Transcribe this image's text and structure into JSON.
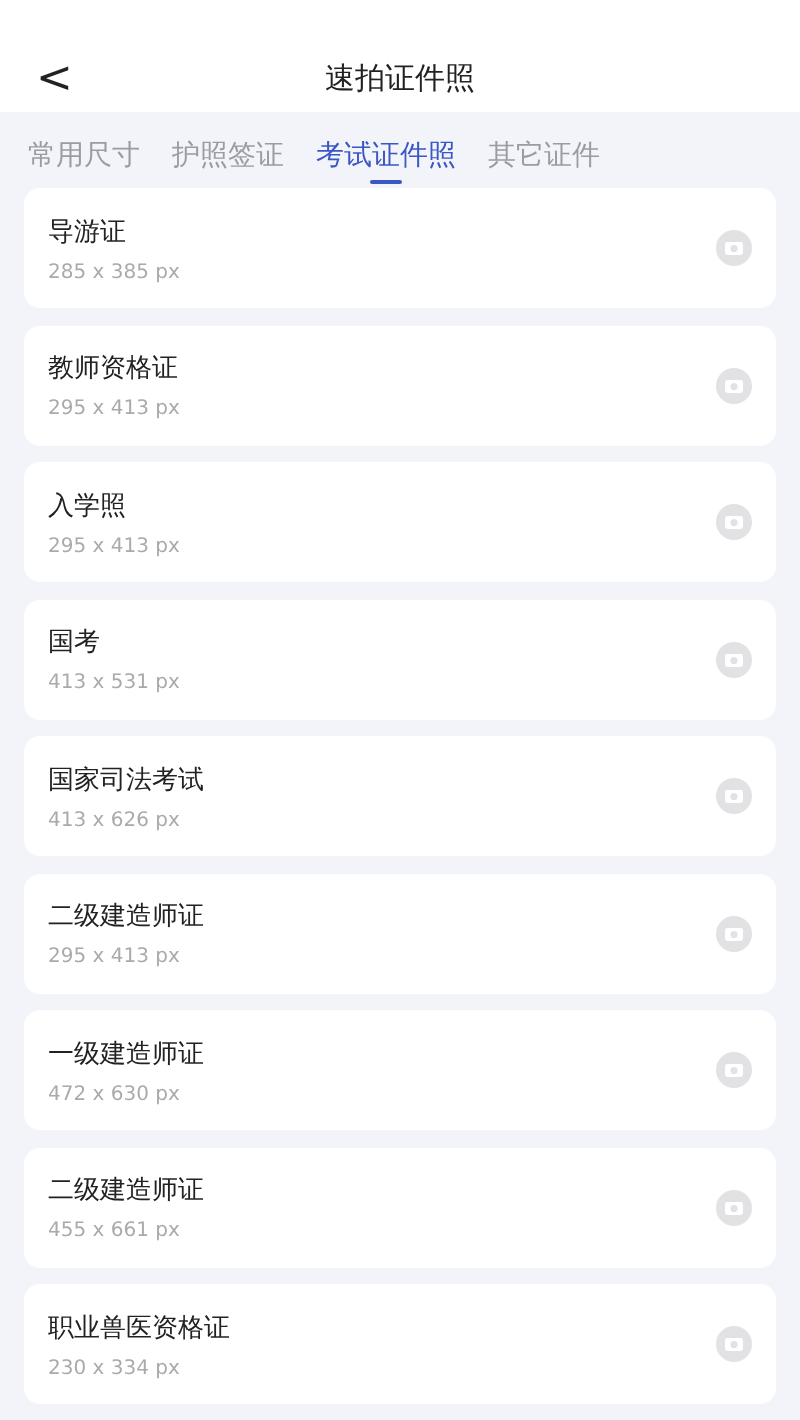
{
  "header": {
    "back": "<",
    "title": "速拍证件照"
  },
  "tabs": [
    {
      "label": "常用尺寸",
      "selected": false
    },
    {
      "label": "护照签证",
      "selected": false
    },
    {
      "label": "考试证件照",
      "selected": true
    },
    {
      "label": "其它证件",
      "selected": false
    }
  ],
  "items": [
    {
      "name": "导游证",
      "size": "285 x 385 px"
    },
    {
      "name": "教师资格证",
      "size": "295 x 413 px"
    },
    {
      "name": "入学照",
      "size": "295 x 413 px"
    },
    {
      "name": "国考",
      "size": "413 x 531 px"
    },
    {
      "name": "国家司法考试",
      "size": "413 x 626 px"
    },
    {
      "name": "二级建造师证",
      "size": "295 x 413 px"
    },
    {
      "name": "一级建造师证",
      "size": "472 x 630 px"
    },
    {
      "name": "二级建造师证",
      "size": "455 x 661 px"
    },
    {
      "name": "职业兽医资格证",
      "size": "230 x 334 px"
    }
  ]
}
